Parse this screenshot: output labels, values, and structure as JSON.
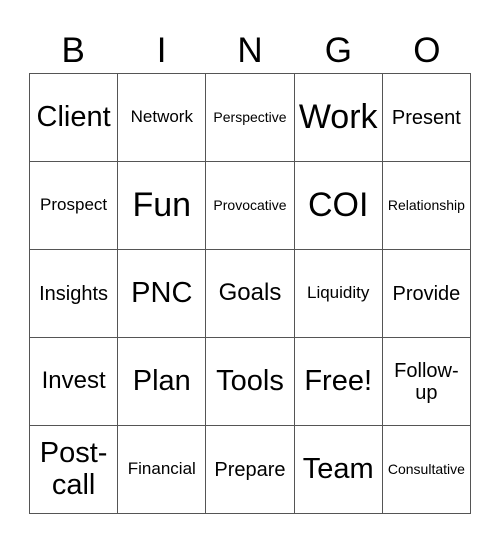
{
  "header": {
    "letters": [
      "B",
      "I",
      "N",
      "G",
      "O"
    ]
  },
  "grid": {
    "rows": [
      [
        "Client",
        "Network",
        "Perspective",
        "Work",
        "Present"
      ],
      [
        "Prospect",
        "Fun",
        "Provocative",
        "COI",
        "Relationship"
      ],
      [
        "Insights",
        "PNC",
        "Goals",
        "Liquidity",
        "Provide"
      ],
      [
        "Invest",
        "Plan",
        "Tools",
        "Free!",
        "Follow-up"
      ],
      [
        "Post-call",
        "Financial",
        "Prepare",
        "Team",
        "Consultative"
      ]
    ]
  }
}
